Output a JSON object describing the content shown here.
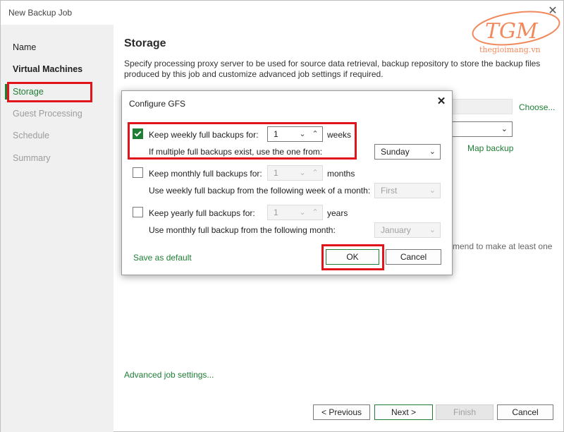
{
  "window": {
    "title": "New Backup Job"
  },
  "sidebar": {
    "steps": [
      {
        "label": "Name",
        "state": "enabled"
      },
      {
        "label": "Virtual Machines",
        "state": "enabled"
      },
      {
        "label": "Storage",
        "state": "active"
      },
      {
        "label": "Guest Processing",
        "state": "disabled"
      },
      {
        "label": "Schedule",
        "state": "disabled"
      },
      {
        "label": "Summary",
        "state": "disabled"
      }
    ]
  },
  "main": {
    "title": "Storage",
    "description": "Specify processing proxy server to be used for source data retrieval, backup repository to store the backup files produced by this job and customize advanced job settings if required.",
    "choose_link": "Choose...",
    "map_backup_link": "Map backup",
    "partial_text": "mend to make at least one",
    "advanced_link": "Advanced job settings..."
  },
  "footer": {
    "previous_label": "< Previous",
    "next_label": "Next >",
    "finish_label": "Finish",
    "cancel_label": "Cancel"
  },
  "dialog": {
    "title": "Configure GFS",
    "weekly": {
      "checked": true,
      "label": "Keep weekly full backups for:",
      "value": "1",
      "unit": "weeks",
      "sub_label": "If multiple full backups exist, use the one from:",
      "selected": "Sunday"
    },
    "monthly": {
      "checked": false,
      "label": "Keep monthly full backups for:",
      "value": "1",
      "unit": "months",
      "sub_label": "Use weekly full backup from the following week of a month:",
      "selected": "First"
    },
    "yearly": {
      "checked": false,
      "label": "Keep yearly full backups for:",
      "value": "1",
      "unit": "years",
      "sub_label": "Use monthly full backup from the following month:",
      "selected": "January"
    },
    "save_default_link": "Save as default",
    "ok_label": "OK",
    "cancel_label": "Cancel"
  },
  "watermark": {
    "letters": "TGM",
    "site": "thegioimang.vn"
  },
  "colors": {
    "accent": "#1e7e34",
    "highlight": "#e0141a",
    "watermark": "#f08a5d"
  }
}
